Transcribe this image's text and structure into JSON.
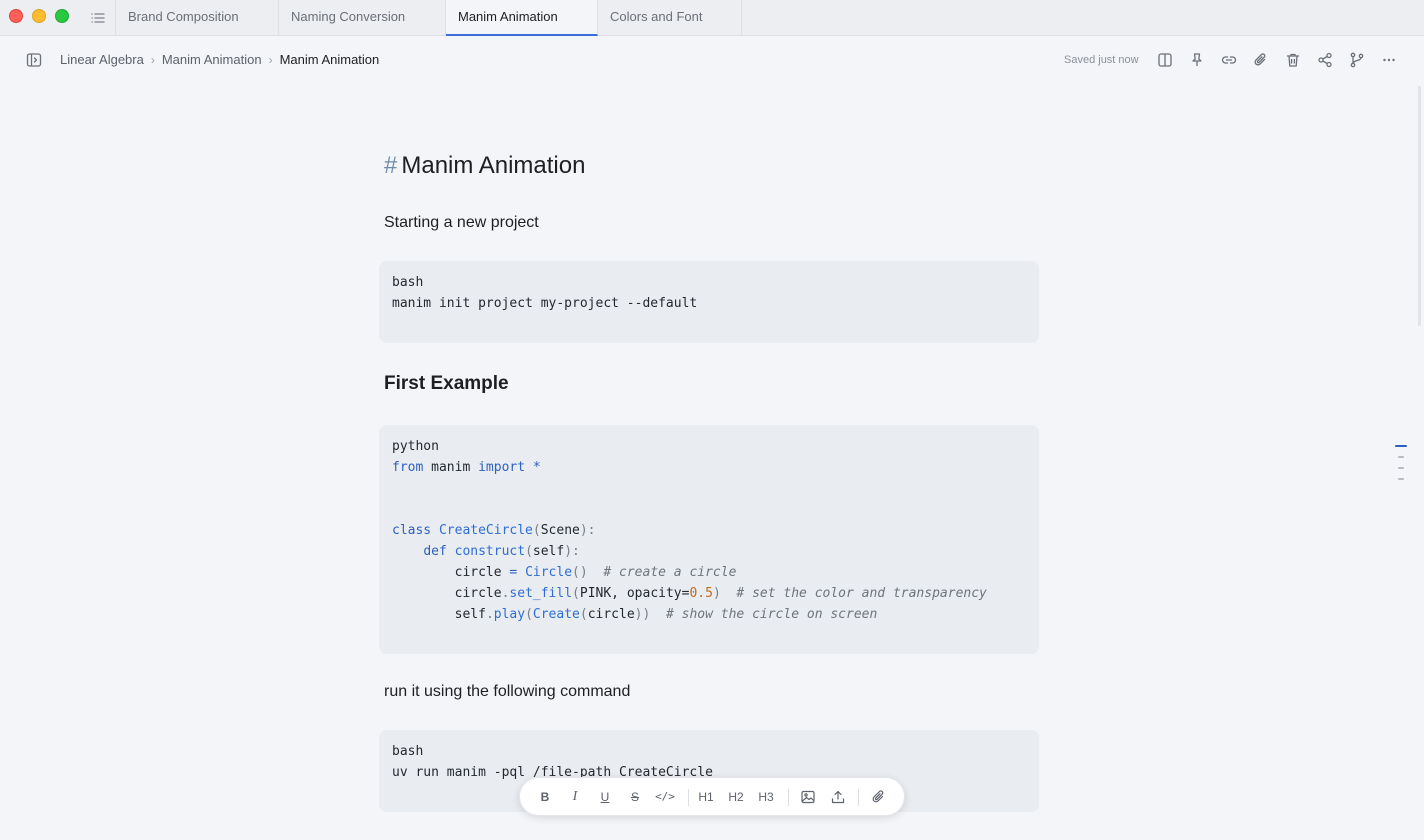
{
  "window": {
    "tabs": [
      {
        "label": "Brand Composition",
        "active": false
      },
      {
        "label": "Naming Conversion",
        "active": false
      },
      {
        "label": "Manim Animation",
        "active": true
      },
      {
        "label": "Colors and Font",
        "active": false
      }
    ]
  },
  "header": {
    "breadcrumb": [
      "Linear Algebra",
      "Manim Animation",
      "Manim Animation"
    ],
    "breadcrumb_separator": "›",
    "save_status": "Saved just now",
    "actions": [
      "split-view-icon",
      "pin-icon",
      "link-icon",
      "attachment-icon",
      "trash-icon",
      "share-icon",
      "branch-icon",
      "more-icon"
    ]
  },
  "document": {
    "title_marker": "#",
    "title": "Manim Animation",
    "intro": "Starting a new project",
    "code1": {
      "lang": "bash",
      "line1": "manim init project my-project --default"
    },
    "section_heading": "First Example",
    "code2": {
      "lang": "python",
      "import_from": "from",
      "import_module": " manim ",
      "import_kw": "import",
      "import_star": " *",
      "class_kw": "class",
      "class_name": "CreateCircle",
      "class_base": "Scene",
      "def_kw": "def",
      "method_name": "construct",
      "method_arg": "self",
      "l1_var": "circle",
      "l1_eq": " = ",
      "l1_call": "Circle",
      "l1_comment": "# create a circle",
      "l2_obj": "circle",
      "l2_method": "set_fill",
      "l2_args": "PINK, opacity=",
      "l2_num": "0.5",
      "l2_comment": "# set the color and transparency",
      "l3_obj": "self",
      "l3_method": "play",
      "l3_call": "Create",
      "l3_arg": "circle",
      "l3_comment": "# show the circle on screen"
    },
    "run_text": "run it using the following command",
    "code3": {
      "lang": "bash",
      "line1": "uv run manim -pql /file-path CreateCircle"
    }
  },
  "format_toolbar": {
    "bold": "B",
    "italic": "I",
    "underline": "U",
    "strike": "S",
    "code": "</>",
    "h1": "H1",
    "h2": "H2",
    "h3": "H3"
  },
  "colors": {
    "accent": "#3b6fd8",
    "background": "#f3f5f8",
    "code_background": "#e9ecf0"
  }
}
